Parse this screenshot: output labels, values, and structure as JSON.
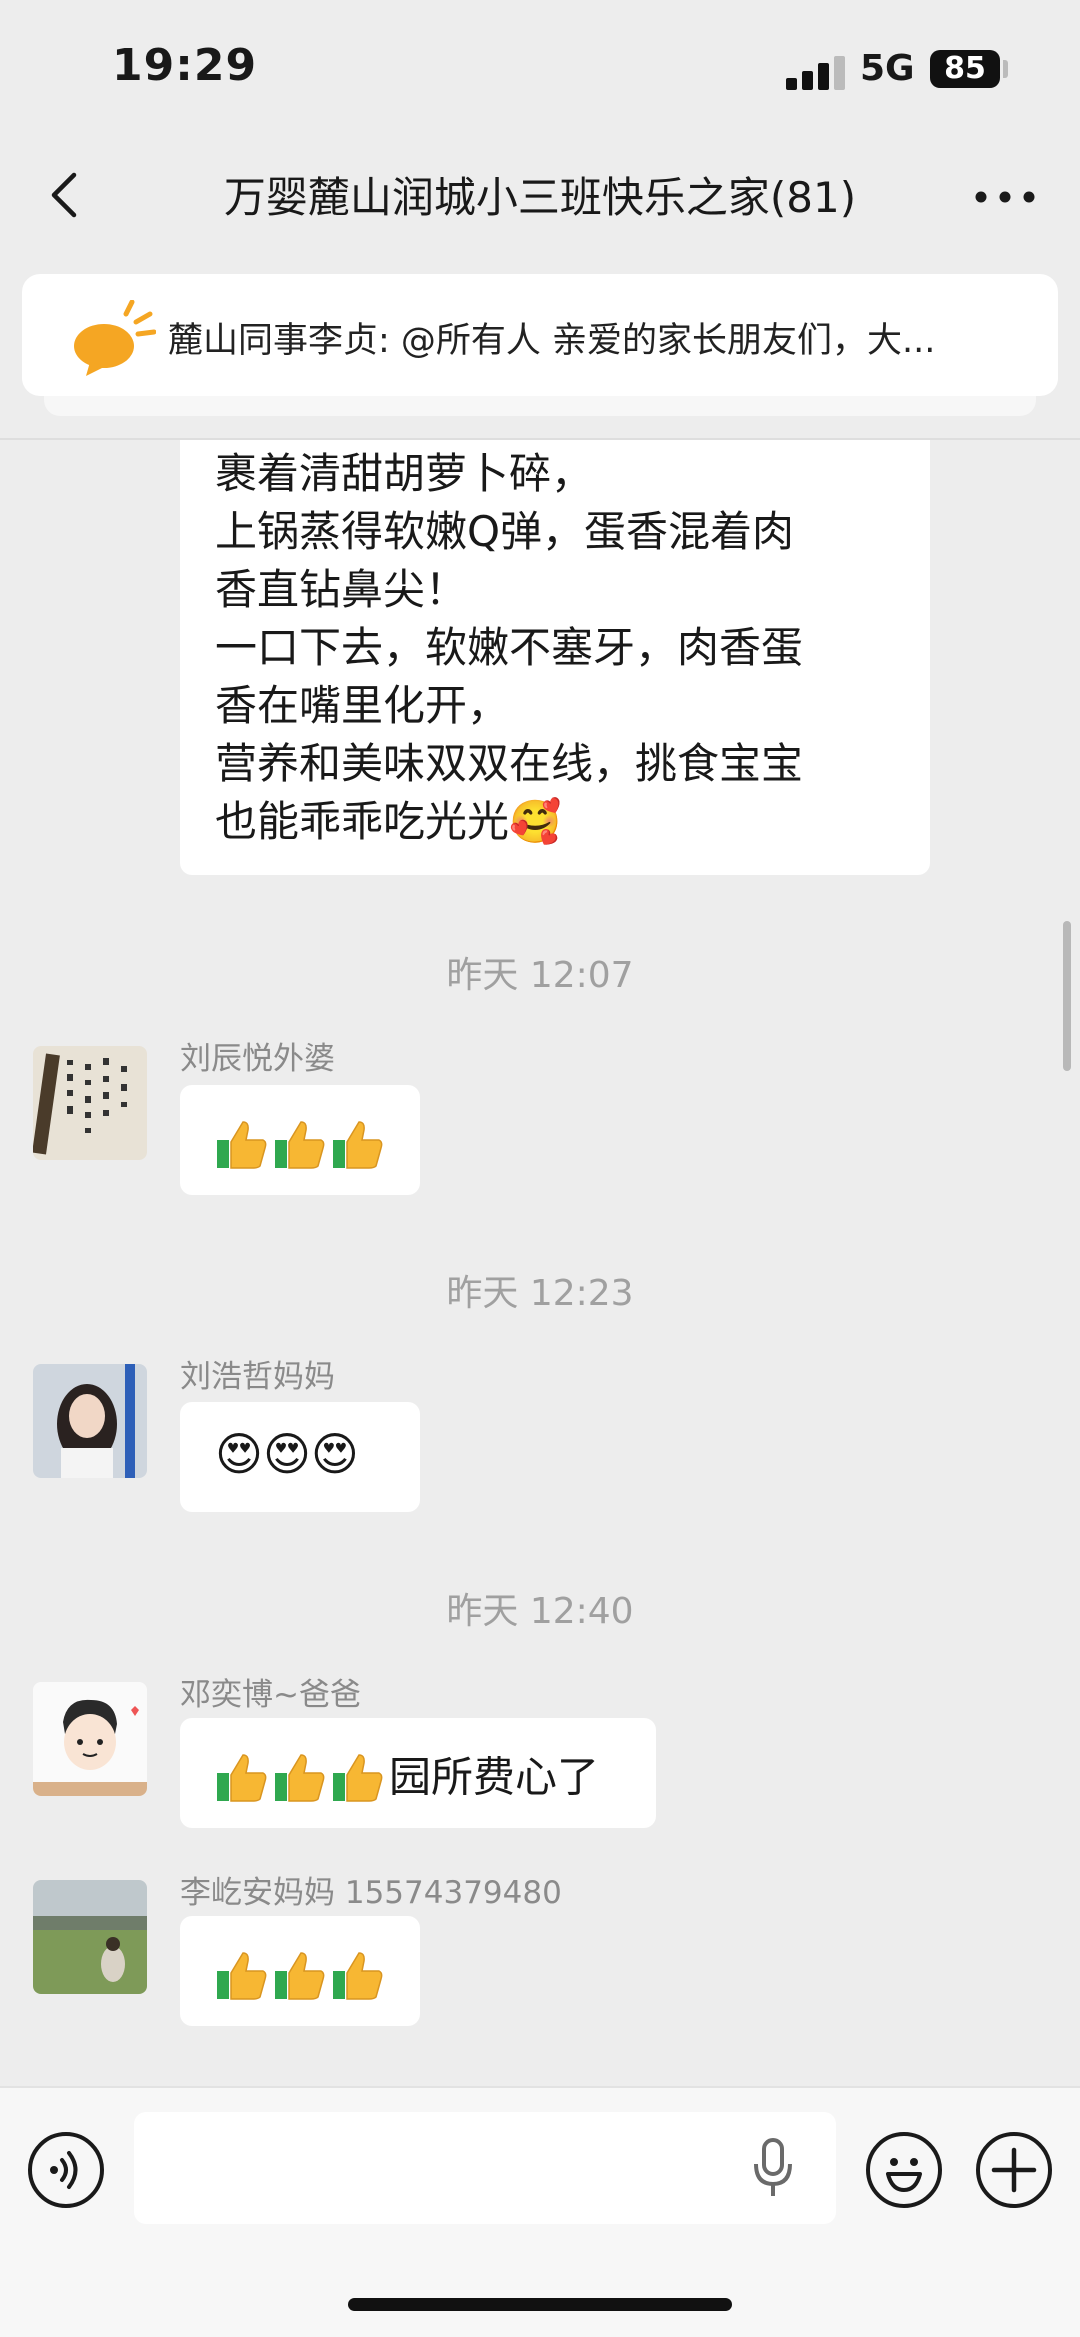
{
  "status_bar": {
    "time": "19:29",
    "network": "5G",
    "battery": "85"
  },
  "header": {
    "title": "万婴麓山润城小三班快乐之家(81)"
  },
  "pinned": {
    "text": "麓山同事李贞: @所有人 亲爱的家长朋友们，大..."
  },
  "messages": {
    "m1": {
      "text": "裹着清甜胡萝卜碎，\n上锅蒸得软嫩Q弹，蛋香混着肉\n香直钻鼻尖！\n一口下去，软嫩不塞牙，肉香蛋\n香在嘴里化开，\n营养和美味双双在线，挑食宝宝\n也能乖乖吃光光🥰"
    },
    "t1": "昨天 12:07",
    "m2": {
      "sender": "刘辰悦外婆"
    },
    "t2": "昨天 12:23",
    "m3": {
      "sender": "刘浩哲妈妈",
      "text": "😍😍😍"
    },
    "t3": "昨天 12:40",
    "m4": {
      "sender": "邓奕博~爸爸",
      "text": "园所费心了"
    },
    "m5": {
      "sender": "李屹安妈妈 15574379480"
    }
  },
  "icons": {
    "back": "chevron-left-icon",
    "more": "more-dots-icon",
    "announce": "megaphone-icon",
    "thumbs": "thumbs-up-icon",
    "voice": "voice-icon",
    "mic": "microphone-icon",
    "emoji": "emoji-icon",
    "plus": "plus-icon"
  },
  "colors": {
    "background": "#ededed",
    "bubble": "#ffffff",
    "accent": "#f5a623"
  }
}
